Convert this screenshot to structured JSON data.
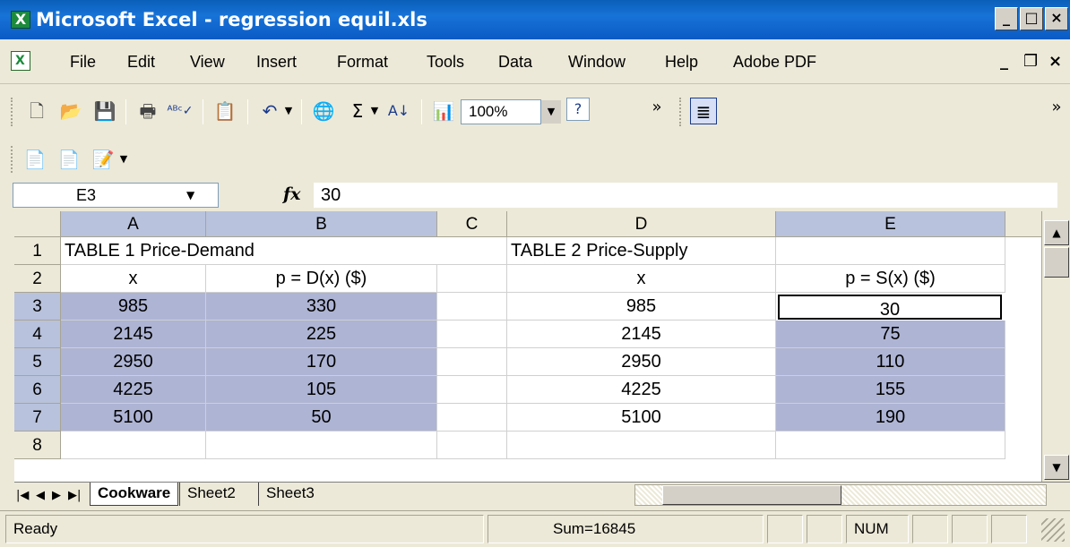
{
  "window": {
    "title": "Microsoft Excel - regression equil.xls",
    "minimize": "_",
    "restore": "□",
    "close": "×"
  },
  "menu": [
    "File",
    "Edit",
    "View",
    "Insert",
    "Format",
    "Tools",
    "Data",
    "Window",
    "Help",
    "Adobe PDF"
  ],
  "mdi": {
    "minimize": "_",
    "restore": "❐",
    "close": "×"
  },
  "toolbar": {
    "zoom": "100%"
  },
  "formula_bar": {
    "name_box": "E3",
    "fx": "fx",
    "value": "30"
  },
  "columns": [
    "A",
    "B",
    "C",
    "D",
    "E"
  ],
  "rows": [
    "1",
    "2",
    "3",
    "4",
    "5",
    "6",
    "7",
    "8"
  ],
  "cells": {
    "A1": "TABLE 1  Price-Demand",
    "A2": "x",
    "B2": "p = D(x) ($)",
    "D1": "TABLE 2  Price-Supply",
    "D2": "x",
    "E2": "p = S(x) ($)",
    "A3": "985",
    "B3": "330",
    "D3": "985",
    "E3": "30",
    "A4": "2145",
    "B4": "225",
    "D4": "2145",
    "E4": "75",
    "A5": "2950",
    "B5": "170",
    "D5": "2950",
    "E5": "110",
    "A6": "4225",
    "B6": "105",
    "D6": "4225",
    "E6": "155",
    "A7": "5100",
    "B7": "50",
    "D7": "5100",
    "E7": "190"
  },
  "sheets": [
    "Cookware",
    "Sheet2",
    "Sheet3"
  ],
  "status": {
    "mode": "Ready",
    "sum": "Sum=16845",
    "num": "NUM"
  },
  "colors": {
    "selection": "#aeb4d4",
    "title_bar": "#0a5fb8"
  }
}
